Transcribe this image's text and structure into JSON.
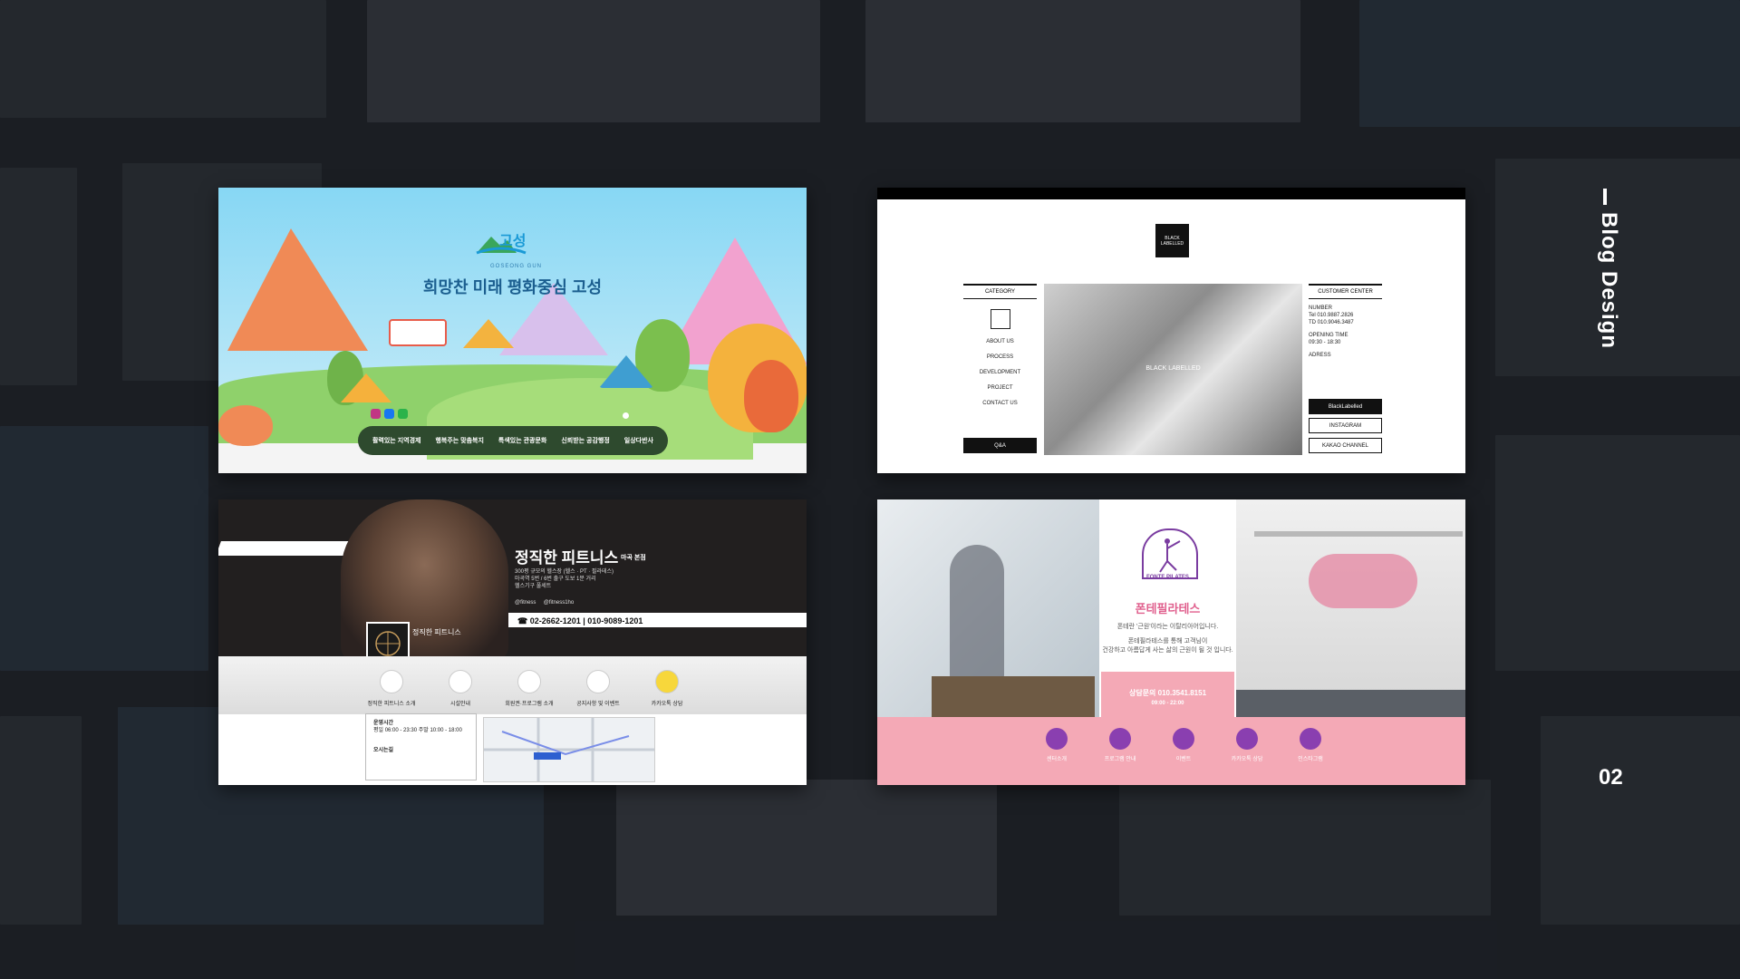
{
  "side_title": "Blog Design",
  "page_number": "02",
  "card_goseong": {
    "logo_text": "고성",
    "subtitle": "GOSEONG GUN",
    "title": "희망찬 미래 평화중심 고성",
    "nav": [
      "활력있는 지역경제",
      "행복주는 맞춤복지",
      "특색있는 관광문화",
      "신뢰받는 공감행정",
      "일상다반사"
    ],
    "social_colors": [
      "#c13584",
      "#1877f2",
      "#2bb34a"
    ]
  },
  "card_blacklabelled": {
    "logo_text": "BLACK LABELLED",
    "category_head": "CATEGORY",
    "menu": [
      "ABOUT US",
      "PROCESS",
      "DEVELOPMENT",
      "PROJECT",
      "CONTACT US"
    ],
    "qa": "Q&A",
    "photo_label": "BLACK LABELLED",
    "customer_head": "CUSTOMER CENTER",
    "number_label": "NUMBER",
    "tel": "Tel   010.9887.2826",
    "tel2": "TD   010.9046.3487",
    "opening_label": "OPENING TIME",
    "opening_time": "09:30 - 18:30",
    "address_label": "ADRESS",
    "btn_blog": "BlackLabelled",
    "btn_instagram": "INSTAGRAM",
    "btn_kakao": "KAKAO CHANNEL"
  },
  "card_fitness": {
    "title": "정직한 피트니스",
    "title_sub": "마곡 본점",
    "desc1": "300평 규모의 헬스장 (헬스 · PT · 필라테스)",
    "desc2": "마곡역 5번 / 6번 출구 도보 1분 거리",
    "desc3": "헬스기구 풀세트",
    "sns1": "@fitness",
    "sns2": "@fitness1ho",
    "phone": "02-2662-1201 | 010-9089-1201",
    "emblem_text": "정직한 피트니스",
    "icons": [
      "정직한 피트니스 소개",
      "시설안내",
      "회원권·프로그램 소개",
      "공지사항 및 이벤트",
      "카카오톡 상담"
    ],
    "hours_title": "운영시간",
    "hours_line": "평일 06:00 - 23:30   주말 10:00 - 18:00",
    "location_title": "오시는길"
  },
  "card_pilates": {
    "logo_text": "FONTE PILATES",
    "brand": "폰테필라테스",
    "desc1": "폰테란 '근원'이라는 이탈리아어입니다.",
    "desc2": "폰테필라테스를 통해 고객님이",
    "desc3": "건강하고 아름답게 사는 삶의 근원이 될 것 입니다.",
    "contact": "상담문의 010.3541.8151",
    "hours": "09:00 - 22:00",
    "icons": [
      "센터소개",
      "프로그램 안내",
      "이벤트",
      "카카오톡 상담",
      "인스타그램"
    ]
  }
}
